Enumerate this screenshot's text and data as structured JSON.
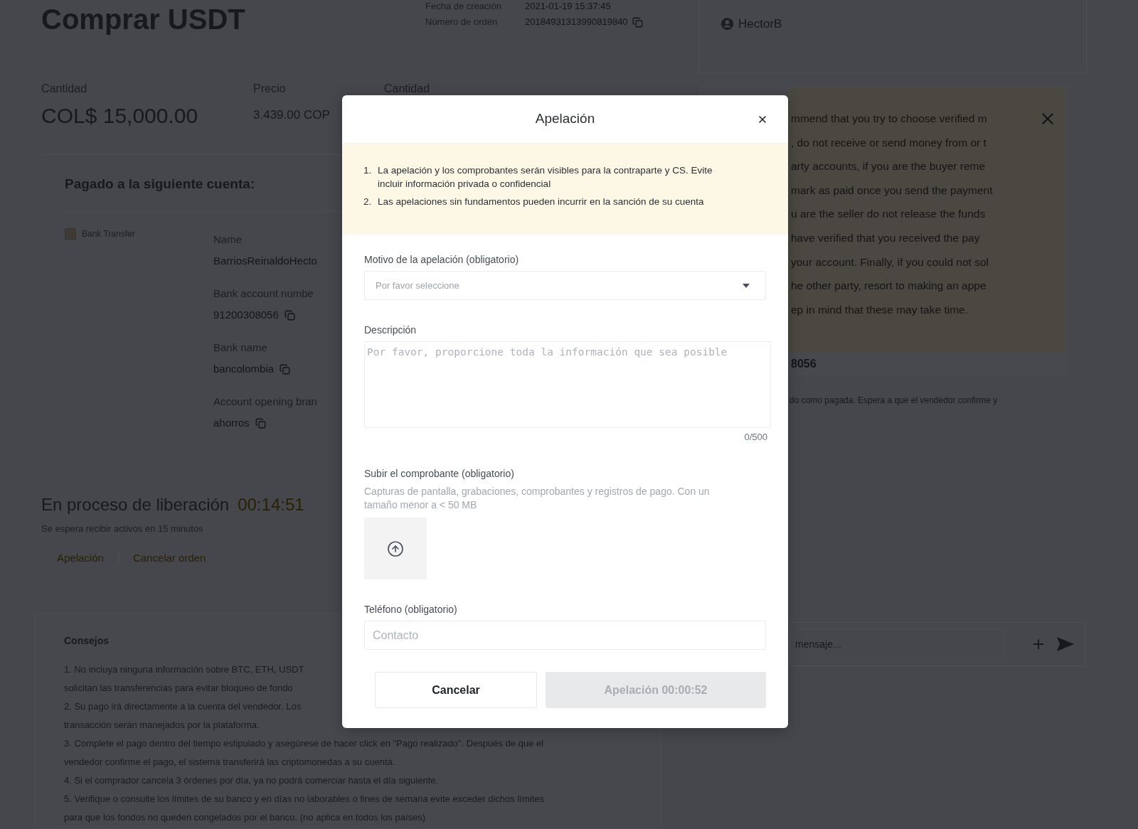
{
  "page": {
    "title": "Comprar USDT",
    "order_meta": [
      {
        "label": "Fecha de creación",
        "value": "2021-01-19 15:37:45",
        "copyable": false
      },
      {
        "label": "Número de orden",
        "value": "20184931313990819840",
        "copyable": true
      }
    ],
    "counterparty": {
      "name": "HectorB"
    },
    "summary": [
      {
        "label": "Cantidad",
        "value": "COL$ 15,000.00",
        "kind": "total"
      },
      {
        "label": "Precio",
        "value": "3.439.00 COP",
        "kind": "price"
      },
      {
        "label": "Cantidad"
      }
    ],
    "payment": {
      "heading": "Pagado a la siguiente cuenta:",
      "method": "Bank Transfer",
      "fields": [
        {
          "label": "Name",
          "value": "BarriosReinaldoHecto",
          "copyable": false
        },
        {
          "label": "Bank account numbe",
          "value": "91200308056",
          "copyable": true
        },
        {
          "label": "Bank name",
          "value": "bancolombia",
          "copyable": true
        },
        {
          "label": "Account opening bran",
          "value": "ahorros",
          "copyable": true
        }
      ]
    },
    "status": {
      "title": "En proceso de liberación",
      "timer": "00:14:51",
      "subtitle": "Se espera recibir activos en 15 minutos",
      "actions": [
        "Apelación",
        "Cancelar orden"
      ]
    },
    "tips": {
      "title": "Consejos",
      "lines": [
        "1. No incluya ninguna información sobre BTC, ETH, USDT",
        "solicitan las transferencias para evitar bloqueo de fondo",
        "2. Su pago irá directamente a la cuenta del vendedor. Los",
        "transacción serán manejados por la plataforma.",
        "3. Complete el pago dentro del tiempo estipulado y asegúrese de hacer click en \"Pago realizado\". Después de que el",
        "vendedor confirme el pago, el sistema transferirá las criptomonedas a su cuenta.",
        "4. Si el comprador cancela 3 órdenes por día, ya no podrá comerciar hasta el día siguiente.",
        "5. Verifique o consulte los límites de su banco y en días no laborables o fines de semana evite exceder dichos límites",
        "para que los fondos no queden congelados por el banco. (no aplica en todos los países)"
      ]
    },
    "notice": {
      "lines": [
        "mmend that you try to choose verified m",
        ", do not receive or send money from or t",
        "arty accounts, if you are the buyer reme",
        "mark as paid once you send the payment",
        "u are the seller do not release the funds",
        "have verified that you received the pay",
        "your account. Finally, if you could not sol",
        "he other party, resort to making an appe",
        "ep in mind that these may take time."
      ]
    },
    "account_tail": "8056",
    "status_note": "do como pagada. Espera a que el vendedor confirme y",
    "chat": {
      "placeholder": "mensaje..."
    }
  },
  "modal": {
    "title": "Apelación",
    "warnings": [
      {
        "number": "1.",
        "text": "La apelación y los comprobantes serán visibles para la contraparte y CS. Evite incluir información privada o confidencial"
      },
      {
        "number": "2.",
        "text": "Las apelaciones sin fundamentos pueden incurrir en la sanción de su cuenta"
      }
    ],
    "reason": {
      "label": "Motivo de la apelación (obligatorio)",
      "placeholder": "Por favor seleccione"
    },
    "description": {
      "label": "Descripción",
      "placeholder": "Por favor, proporcione toda la información que sea posible",
      "counter": "0/500"
    },
    "upload": {
      "label": "Subir el comprobante (obligatorio)",
      "hint": "Capturas de pantalla, grabaciones, comprobantes y registros de pago. Con un tamaño menor a < 50 MB"
    },
    "phone": {
      "label": "Teléfono (obligatorio)",
      "placeholder": "Contacto"
    },
    "buttons": [
      {
        "label": "Cancelar",
        "kind": "secondary",
        "disabled": false
      },
      {
        "label": "Apelación 00:00:52",
        "kind": "primary",
        "disabled": true
      }
    ]
  }
}
